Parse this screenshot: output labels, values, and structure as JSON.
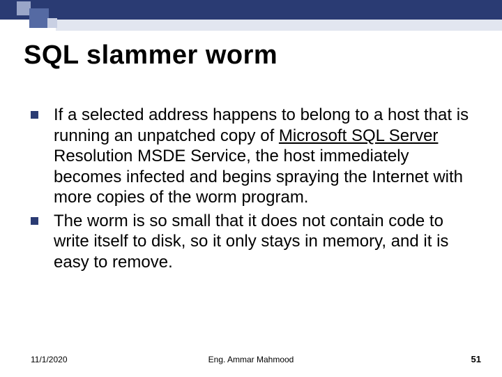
{
  "title": "SQL slammer worm",
  "bullets": [
    {
      "pre": "If a selected address happens to belong to a host that is running an unpatched copy of ",
      "underlined": "Microsoft SQL Server",
      "post": " Resolution MSDE Service, the host immediately becomes infected and begins spraying the Internet with more copies of the worm program."
    },
    {
      "pre": " The worm is so small that it does not contain code to write itself to disk, so it only stays in memory, and it is easy to remove.",
      "underlined": "",
      "post": ""
    }
  ],
  "footer": {
    "date": "11/1/2020",
    "author": "Eng. Ammar Mahmood",
    "page": "51"
  }
}
